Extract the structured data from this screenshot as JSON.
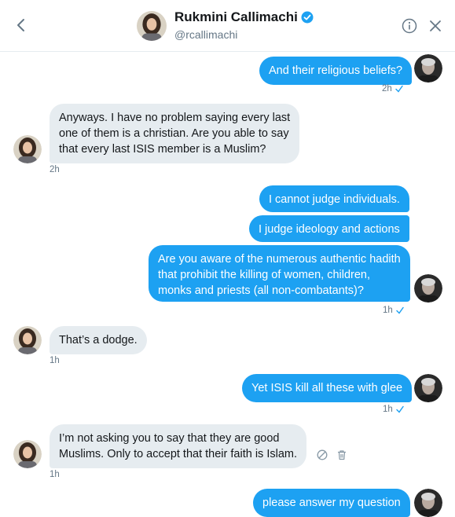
{
  "header": {
    "name": "Rukmini Callimachi",
    "handle": "@rcallimachi"
  },
  "messages": [
    {
      "text": "And their religious beliefs?",
      "time": "2h"
    },
    {
      "lines": [
        "Anyways. I have no problem saying every last",
        "one of them is a christian. Are you able to say",
        "that every last ISIS member is a Muslim?"
      ],
      "time": "2h"
    },
    {
      "text": "I cannot judge individuals."
    },
    {
      "text": "I judge ideology and actions"
    },
    {
      "lines": [
        "Are you aware of the numerous authentic hadith",
        "that prohibit the killing of women, children,",
        "monks and priests (all non-combatants)?"
      ],
      "time": "1h"
    },
    {
      "text": "That’s a dodge.",
      "time": "1h"
    },
    {
      "text": "Yet ISIS kill all these with glee",
      "time": "1h"
    },
    {
      "lines": [
        "I’m not asking you to say that they are good",
        "Muslims. Only to accept that their faith is Islam."
      ],
      "time": "1h"
    },
    {
      "text": "please answer my question"
    }
  ],
  "colors": {
    "accent": "#1da1f2",
    "received_bubble": "#e6ecf0",
    "muted_text": "#657786"
  },
  "icons": [
    "back-chevron-icon",
    "verified-badge-icon",
    "info-icon",
    "close-icon",
    "read-check-icon",
    "report-icon",
    "trash-icon"
  ]
}
